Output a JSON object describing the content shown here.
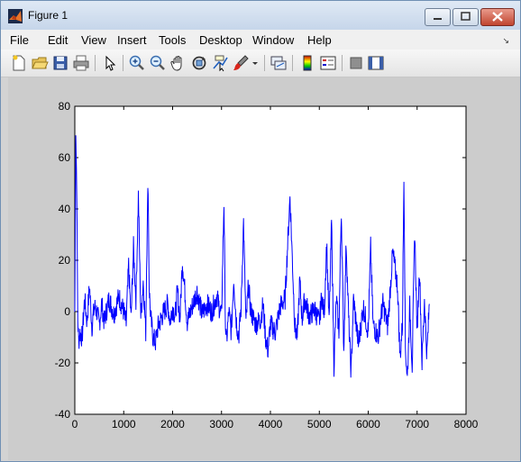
{
  "window": {
    "title": "Figure 1"
  },
  "menu": [
    "File",
    "Edit",
    "View",
    "Insert",
    "Tools",
    "Desktop",
    "Window",
    "Help"
  ],
  "toolbar_icons": [
    "new-figure-icon",
    "open-file-icon",
    "save-icon",
    "print-icon",
    "edit-plot-arrow-icon",
    "zoom-in-icon",
    "zoom-out-icon",
    "pan-hand-icon",
    "rotate-3d-icon",
    "data-cursor-icon",
    "brush-icon",
    "brush-dropdown-icon",
    "link-plot-icon",
    "colorbar-icon",
    "legend-icon",
    "hide-plot-tools-icon",
    "show-plot-tools-icon"
  ],
  "colors": {
    "line": "#0000ff",
    "figure_bg": "#cccccc",
    "axes_bg": "#ffffff"
  },
  "chart_data": {
    "type": "line",
    "title": "",
    "xlabel": "",
    "ylabel": "",
    "xlim": [
      0,
      8000
    ],
    "ylim": [
      -40,
      80
    ],
    "xticks": [
      0,
      1000,
      2000,
      3000,
      4000,
      5000,
      6000,
      7000,
      8000
    ],
    "yticks": [
      -40,
      -20,
      0,
      20,
      40,
      60,
      80
    ],
    "grid": false,
    "series": [
      {
        "color": "#0000ff",
        "x": [
          0,
          20,
          40,
          60,
          80,
          100,
          150,
          200,
          250,
          300,
          350,
          400,
          450,
          500,
          550,
          600,
          700,
          800,
          900,
          1000,
          1050,
          1100,
          1150,
          1200,
          1250,
          1300,
          1350,
          1400,
          1450,
          1480,
          1500,
          1520,
          1550,
          1600,
          1650,
          1700,
          1800,
          1900,
          1950,
          2000,
          2050,
          2100,
          2150,
          2200,
          2300,
          2400,
          2500,
          2600,
          2700,
          2800,
          2900,
          3000,
          3050,
          3080,
          3100,
          3150,
          3200,
          3250,
          3300,
          3350,
          3400,
          3450,
          3500,
          3550,
          3600,
          3700,
          3800,
          3850,
          3900,
          3950,
          4000,
          4100,
          4200,
          4300,
          4400,
          4500,
          4550,
          4600,
          4650,
          4700,
          4800,
          4900,
          5000,
          5050,
          5100,
          5150,
          5200,
          5250,
          5300,
          5350,
          5400,
          5450,
          5500,
          5550,
          5600,
          5650,
          5700,
          5800,
          5900,
          6000,
          6050,
          6100,
          6200,
          6300,
          6400,
          6500,
          6600,
          6650,
          6700,
          6730,
          6760,
          6800,
          6850,
          6900,
          6950,
          7000,
          7050,
          7100,
          7150,
          7200,
          7250
        ],
        "y": [
          0,
          71,
          48,
          -3,
          -12,
          -8,
          -10,
          5,
          -4,
          10,
          -6,
          2,
          0,
          -5,
          3,
          -4,
          5,
          -1,
          6,
          0,
          -5,
          18,
          -3,
          25,
          5,
          45,
          -2,
          12,
          -8,
          35,
          50,
          10,
          -2,
          -10,
          -12,
          -6,
          -1,
          3,
          -4,
          2,
          -2,
          8,
          -3,
          20,
          -4,
          2,
          8,
          -1,
          3,
          0,
          6,
          -2,
          43,
          -5,
          -12,
          0,
          -8,
          13,
          -3,
          -10,
          1,
          35,
          -5,
          10,
          0,
          -5,
          -3,
          3,
          -10,
          -15,
          -5,
          -8,
          2,
          5,
          45,
          -6,
          -10,
          12,
          -3,
          5,
          -2,
          1,
          -4,
          6,
          -1,
          27,
          -5,
          35,
          -21,
          5,
          -8,
          40,
          -15,
          27,
          -3,
          -24,
          5,
          -13,
          2,
          -8,
          25,
          -5,
          -10,
          3,
          -6,
          23,
          10,
          -18,
          -5,
          55,
          -14,
          -26,
          2,
          -21,
          32,
          -8,
          17,
          -20,
          5,
          -17,
          3
        ]
      }
    ]
  }
}
